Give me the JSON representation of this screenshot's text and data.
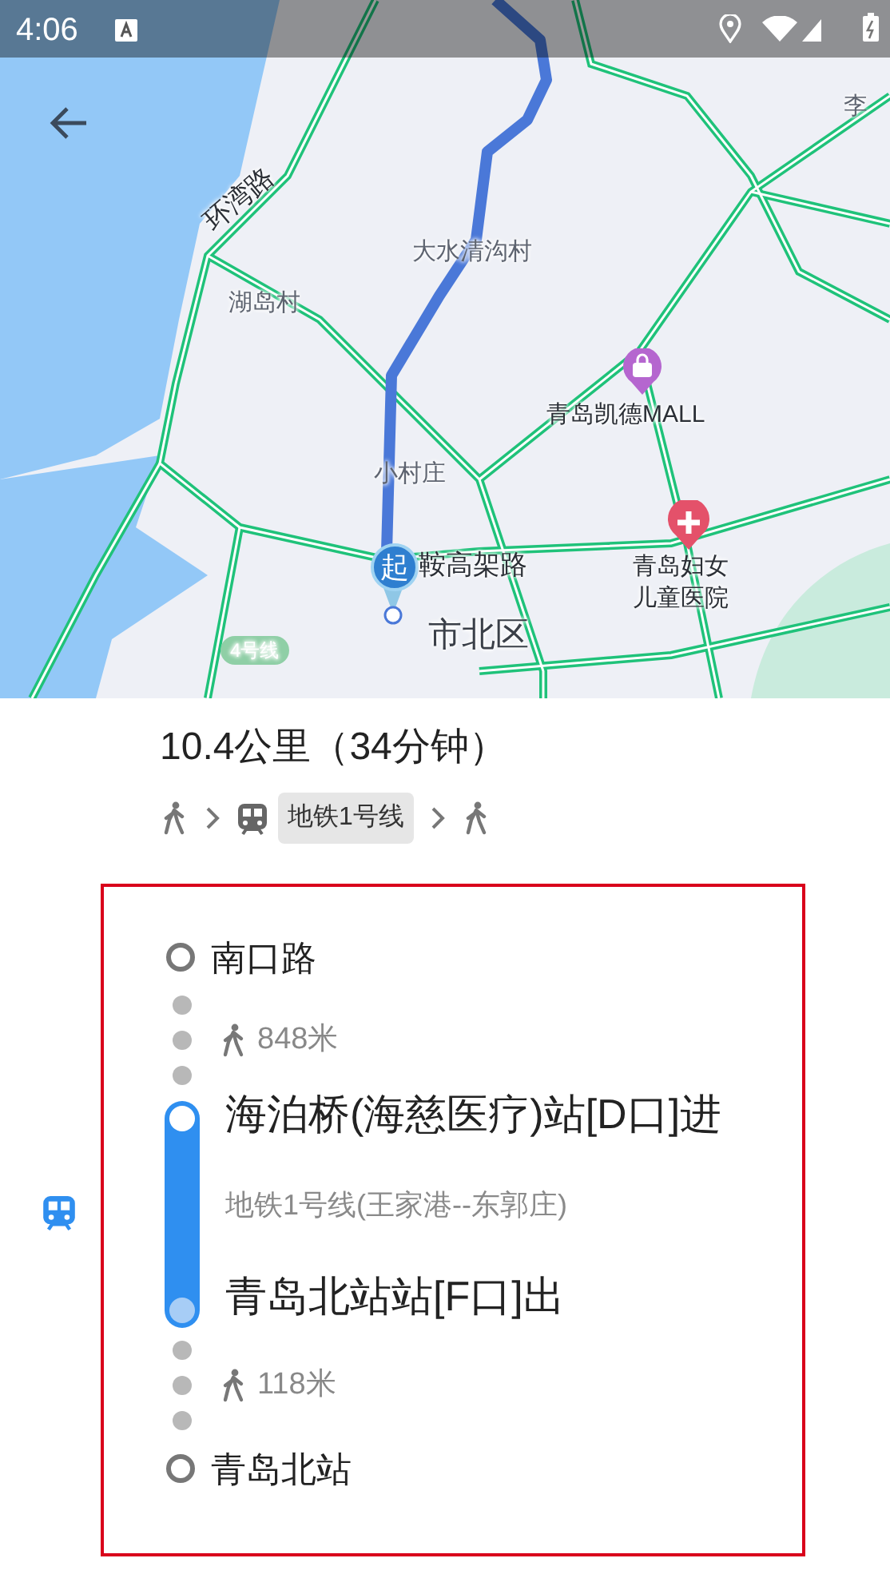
{
  "status_bar": {
    "time": "4:06"
  },
  "map": {
    "start_marker": "起",
    "labels": [
      {
        "text": "李",
        "kind": "area"
      },
      {
        "text": "环湾路",
        "kind": "road"
      },
      {
        "text": "大水清沟村",
        "kind": "area"
      },
      {
        "text": "湖岛村",
        "kind": "area"
      },
      {
        "text": "青岛凯德MALL",
        "kind": "poi"
      },
      {
        "text": "小村庄",
        "kind": "area"
      },
      {
        "text": "鞍高架路",
        "kind": "road"
      },
      {
        "text": "青岛妇女儿童医院",
        "kind": "poi"
      },
      {
        "text": "市北区",
        "kind": "district"
      },
      {
        "text": "4号线",
        "kind": "metro"
      }
    ]
  },
  "route": {
    "summary": "10.4公里（34分钟）",
    "steps": [
      {
        "kind": "walk"
      },
      {
        "kind": "subway",
        "label": "地铁1号线"
      },
      {
        "kind": "walk"
      }
    ]
  },
  "itinerary": [
    {
      "kind": "place",
      "name": "南口路"
    },
    {
      "kind": "walk",
      "distance": "848米"
    },
    {
      "kind": "subway",
      "board": "海泊桥(海慈医疗)站[D口]进",
      "line": "地铁1号线(王家港--东郭庄)",
      "alight": "青岛北站站[F口]出"
    },
    {
      "kind": "walk",
      "distance": "118米"
    },
    {
      "kind": "place",
      "name": "青岛北站"
    }
  ]
}
